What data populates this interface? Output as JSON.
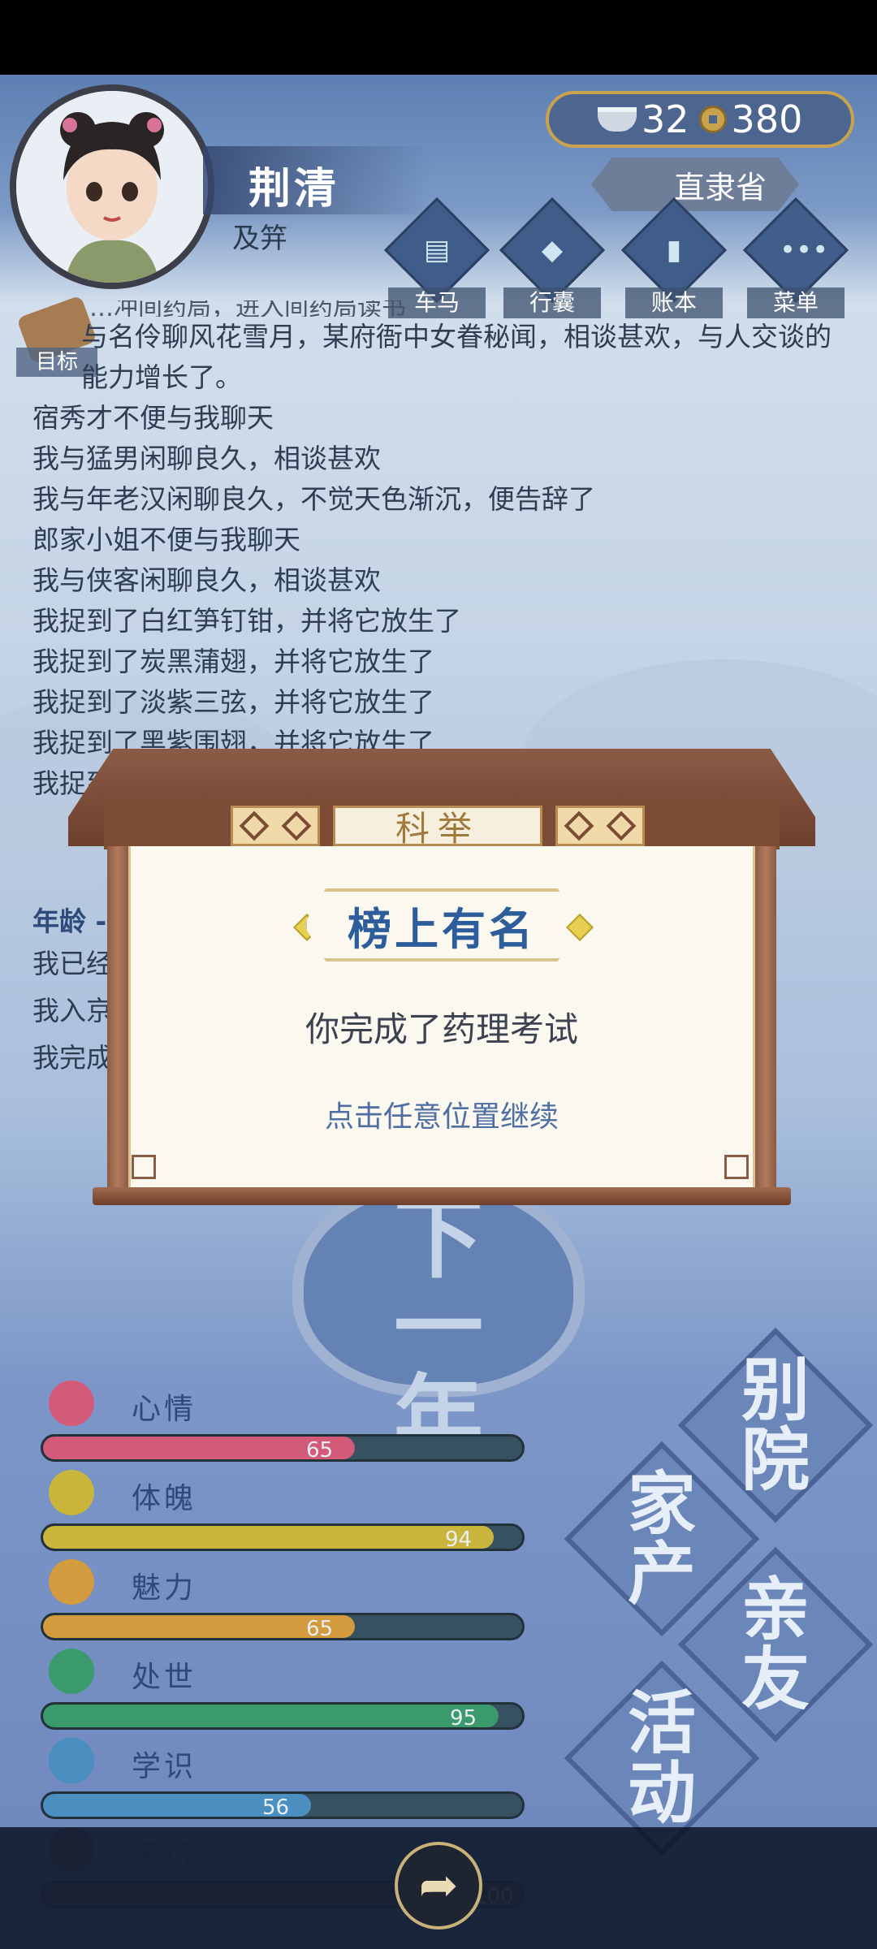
{
  "player": {
    "name": "荆清",
    "title": "及笄"
  },
  "currency": {
    "silver": "32",
    "coins": "380"
  },
  "location": "直隶省",
  "nav": [
    {
      "label": "车马",
      "icon": "carriage-icon"
    },
    {
      "label": "行囊",
      "icon": "bag-icon"
    },
    {
      "label": "账本",
      "icon": "ledger-icon"
    },
    {
      "label": "菜单",
      "icon": "menu-icon"
    }
  ],
  "goal_label": "目标",
  "log": {
    "partial_top": "…冲间药局，进入间药局读书",
    "lines": [
      "与名伶聊风花雪月，某府衙中女眷秘闻，相谈甚欢，与人交谈的能力增长了。",
      "宿秀才不便与我聊天",
      "我与猛男闲聊良久，相谈甚欢",
      "我与年老汉闲聊良久，不觉天色渐沉，便告辞了",
      "郎家小姐不便与我聊天",
      "我与侠客闲聊良久，相谈甚欢",
      "我捉到了白红笋钉钳，并将它放生了",
      "我捉到了炭黑蒲翅，并将它放生了",
      "我捉到了淡紫三弦，并将它放生了",
      "我捉到了黑紫围翅，并将它放生了",
      "我捉到"
    ],
    "section_title": "年龄 -",
    "section_lines": [
      "我已经",
      "我入京",
      "我完成"
    ]
  },
  "center_button": {
    "line1": "下一",
    "line2": "年"
  },
  "stats": [
    {
      "name": "心情",
      "value": 65,
      "color": "#d35a78",
      "icon": "flower-icon"
    },
    {
      "name": "体魄",
      "value": 94,
      "color": "#c9b53c",
      "icon": "drum-icon"
    },
    {
      "name": "魅力",
      "value": 65,
      "color": "#d49a3e",
      "icon": "mirror-icon"
    },
    {
      "name": "处世",
      "value": 95,
      "color": "#3b9a6b",
      "icon": "scroll-icon"
    },
    {
      "name": "学识",
      "value": 56,
      "color": "#4a8fc0",
      "icon": "books-icon"
    },
    {
      "name": "德行",
      "value": 100,
      "color": "#7a3a5a",
      "icon": "virtue-icon"
    }
  ],
  "side_buttons": [
    {
      "line1": "别",
      "line2": "院"
    },
    {
      "line1": "家",
      "line2": "产"
    },
    {
      "line1": "亲",
      "line2": "友"
    },
    {
      "line1": "活",
      "line2": "动"
    }
  ],
  "modal": {
    "category": "科举",
    "headline": "榜上有名",
    "message": "你完成了药理考试",
    "hint": "点击任意位置继续"
  }
}
